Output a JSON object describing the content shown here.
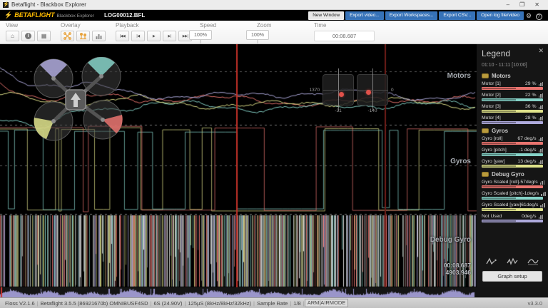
{
  "window": {
    "title": "Betaflight - Blackbox Explorer",
    "controls": {
      "minimize": "–",
      "maximize": "❐",
      "close": "✕"
    }
  },
  "appbar": {
    "brand": "BETAFLIGHT",
    "brand_sub": "Blackbox Explorer",
    "filename": "LOG00012.BFL",
    "buttons": [
      {
        "label": "New Window",
        "style": "light"
      },
      {
        "label": "Export video...",
        "style": "blue"
      },
      {
        "label": "Export Workspaces...",
        "style": "blue"
      },
      {
        "label": "Export CSV...",
        "style": "blue"
      },
      {
        "label": "Open log file/video",
        "style": "blue"
      }
    ]
  },
  "toolbar": {
    "view": {
      "label": "View",
      "home_icon": "⌂",
      "info_icon": "i",
      "table_icon": "▦"
    },
    "overlay": {
      "label": "Overlay"
    },
    "playback": {
      "label": "Playback",
      "symbols": [
        "|◀◀",
        "|◀",
        "▶",
        "▶|",
        "▶▶|"
      ]
    },
    "speed": {
      "label": "Speed",
      "value": "100%"
    },
    "zoom": {
      "label": "Zoom",
      "value": "100%"
    },
    "time": {
      "label": "Time",
      "value": "00:08.687"
    }
  },
  "chart": {
    "section_labels": [
      "Motors",
      "Gyros",
      "Debug Gyro"
    ],
    "cursor_time": "00:08.687",
    "cursor_frame": "4903.946",
    "sticks": {
      "left_value": "1370",
      "left_lower": "-31",
      "right_lower": "-140",
      "right_value": "0"
    },
    "colors": {
      "motor1": "#e9746f",
      "motor2": "#86d3c8",
      "motor3": "#dfe28a",
      "motor4": "#aeaadc",
      "cursor": "#c23128",
      "cursor_dim": "#6f1d18",
      "seek_wave": "#a9a3de"
    }
  },
  "legend": {
    "title": "Legend",
    "close_icon": "✕",
    "range": "01:10 - 11:11 [10:00]",
    "groups": [
      {
        "name": "Motors",
        "fields": [
          {
            "name": "Motor [1]",
            "value": "29 %",
            "color": "#e9746f"
          },
          {
            "name": "Motor [2]",
            "value": "22 %",
            "color": "#86d3c8"
          },
          {
            "name": "Motor [3]",
            "value": "36 %",
            "color": "#dfe28a"
          },
          {
            "name": "Motor [4]",
            "value": "28 %",
            "color": "#aeaadc"
          }
        ]
      },
      {
        "name": "Gyros",
        "fields": [
          {
            "name": "Gyro [roll]",
            "value": "67 deg/s",
            "color": "#e9746f"
          },
          {
            "name": "Gyro [pitch]",
            "value": "-1 deg/s",
            "color": "#86d3c8"
          },
          {
            "name": "Gyro [yaw]",
            "value": "13 deg/s",
            "color": "#dfe28a"
          }
        ]
      },
      {
        "name": "Debug Gyro",
        "fields": [
          {
            "name": "Gyro Scaled [roll]",
            "value": "-57deg/s",
            "color": "#e9746f"
          },
          {
            "name": "Gyro Scaled [pitch]",
            "value": "-1deg/s",
            "color": "#86d3c8"
          },
          {
            "name": "Gyro Scaled [yaw]",
            "value": "61deg/s",
            "color": "#dfe28a"
          },
          {
            "name": "Not Used",
            "value": "0deg/s",
            "color": "#aeaadc"
          }
        ]
      }
    ],
    "graph_setup_label": "Graph setup"
  },
  "statusbar": {
    "segments": [
      "Floss V2.1.6",
      "Betaflight 3.5.5 (86921670b) OMNIBUSF4SD",
      "6S (24.90V)",
      "125µS (8kHz/8kHz/32kHz)",
      "Sample Rate",
      "1/8",
      "ARM|AIRMODE"
    ],
    "version": "v3.3.0"
  }
}
